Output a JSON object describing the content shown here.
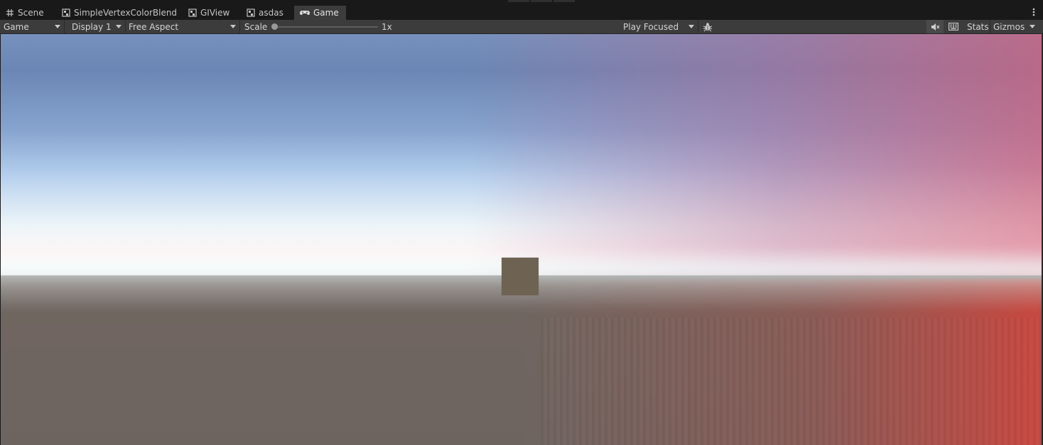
{
  "tabs": [
    {
      "label": "Scene",
      "icon": "grid-icon",
      "active": false
    },
    {
      "label": "SimpleVertexColorBlend",
      "icon": "graph-icon",
      "active": false
    },
    {
      "label": "GIView",
      "icon": "graph-icon",
      "active": false
    },
    {
      "label": "asdas",
      "icon": "graph-icon",
      "active": false
    },
    {
      "label": "Game",
      "icon": "gamepad-icon",
      "active": true
    }
  ],
  "toolbar": {
    "view_mode": "Game",
    "display": "Display 1",
    "aspect": "Free Aspect",
    "scale_label": "Scale",
    "scale_value": "1x",
    "play_mode": "Play Focused",
    "stats_label": "Stats",
    "gizmos_label": "Gizmos"
  },
  "colors": {
    "panel": "#3c3c3c",
    "tabbar": "#191919",
    "text": "#d2d2d2",
    "sky_blue": "#7691bd",
    "sky_red": "#d2607a",
    "ground": "#6d6460",
    "ground_red": "#c8483f",
    "cube": "#6e6352"
  }
}
